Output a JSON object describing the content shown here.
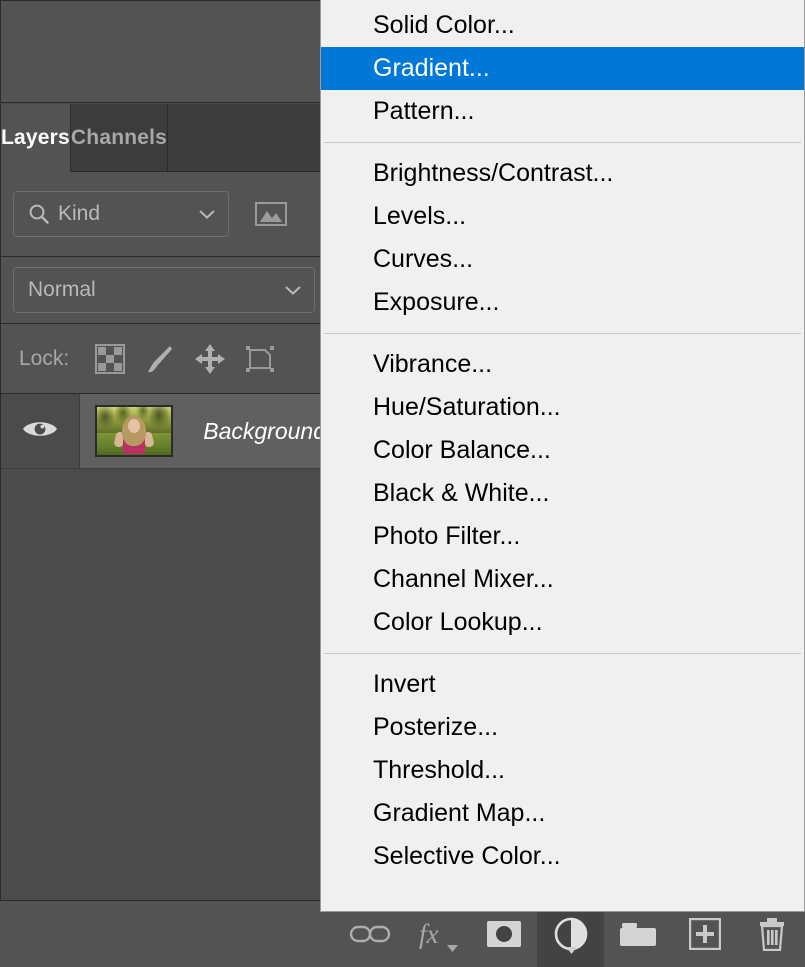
{
  "panel": {
    "tabs": [
      {
        "label": "Layers",
        "active": true
      },
      {
        "label": "Channels",
        "active": false
      }
    ],
    "filter": {
      "kind_label": "Kind",
      "search_icon": "search-icon",
      "chevron_icon": "chevron-down-icon",
      "pixel_filter_icon": "image-filter-icon"
    },
    "blend": {
      "mode": "Normal",
      "chevron_icon": "chevron-down-icon"
    },
    "lock": {
      "label": "Lock:",
      "icons": [
        "transparent-pixels-icon",
        "image-pixels-brush-icon",
        "position-move-icon",
        "artboard-nesting-icon"
      ]
    },
    "layers": [
      {
        "name": "Background",
        "visible": true,
        "eye_icon": "eye-icon",
        "thumbnail": "photo-thumbnail"
      }
    ],
    "bottom_toolbar": [
      {
        "name": "link-layers-icon",
        "label": "",
        "active": false,
        "caret": false
      },
      {
        "name": "fx-layer-style-icon",
        "label": "fx",
        "active": false,
        "caret": true
      },
      {
        "name": "add-layer-mask-icon",
        "label": "",
        "active": false,
        "caret": false
      },
      {
        "name": "new-adjustment-layer-icon",
        "label": "",
        "active": true,
        "caret": true
      },
      {
        "name": "new-group-folder-icon",
        "label": "",
        "active": false,
        "caret": false
      },
      {
        "name": "new-layer-icon",
        "label": "",
        "active": false,
        "caret": false
      },
      {
        "name": "delete-layer-trash-icon",
        "label": "",
        "active": false,
        "caret": false
      }
    ]
  },
  "menu": {
    "title": "new-adjustment-layer-menu",
    "selected": "Gradient...",
    "highlight_color": "#0078d7",
    "background_color": "#f0f0f0",
    "groups": [
      {
        "items": [
          {
            "label": "Solid Color...",
            "selected": false
          },
          {
            "label": "Gradient...",
            "selected": true
          },
          {
            "label": "Pattern...",
            "selected": false
          }
        ]
      },
      {
        "items": [
          {
            "label": "Brightness/Contrast...",
            "selected": false
          },
          {
            "label": "Levels...",
            "selected": false
          },
          {
            "label": "Curves...",
            "selected": false
          },
          {
            "label": "Exposure...",
            "selected": false
          }
        ]
      },
      {
        "items": [
          {
            "label": "Vibrance...",
            "selected": false
          },
          {
            "label": "Hue/Saturation...",
            "selected": false
          },
          {
            "label": "Color Balance...",
            "selected": false
          },
          {
            "label": "Black & White...",
            "selected": false
          },
          {
            "label": "Photo Filter...",
            "selected": false
          },
          {
            "label": "Channel Mixer...",
            "selected": false
          },
          {
            "label": "Color Lookup...",
            "selected": false
          }
        ]
      },
      {
        "items": [
          {
            "label": "Invert",
            "selected": false
          },
          {
            "label": "Posterize...",
            "selected": false
          },
          {
            "label": "Threshold...",
            "selected": false
          },
          {
            "label": "Gradient Map...",
            "selected": false
          },
          {
            "label": "Selective Color...",
            "selected": false
          }
        ]
      }
    ]
  }
}
